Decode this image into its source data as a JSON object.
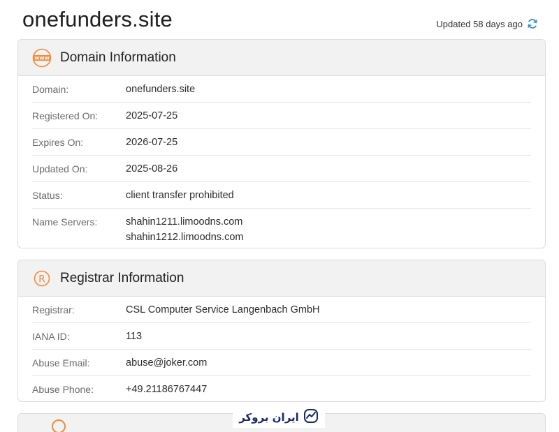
{
  "header": {
    "domain_title": "onefunders.site",
    "updated_text": "Updated 58 days ago"
  },
  "domain_info": {
    "title": "Domain Information",
    "icon": "www-icon",
    "rows": [
      {
        "label": "Domain:",
        "values": [
          "onefunders.site"
        ]
      },
      {
        "label": "Registered On:",
        "values": [
          "2025-07-25"
        ]
      },
      {
        "label": "Expires On:",
        "values": [
          "2026-07-25"
        ]
      },
      {
        "label": "Updated On:",
        "values": [
          "2025-08-26"
        ]
      },
      {
        "label": "Status:",
        "values": [
          "client transfer prohibited"
        ]
      },
      {
        "label": "Name Servers:",
        "values": [
          "shahin1211.limoodns.com",
          "shahin1212.limoodns.com"
        ]
      }
    ]
  },
  "registrar_info": {
    "title": "Registrar Information",
    "icon": "registered-icon",
    "rows": [
      {
        "label": "Registrar:",
        "values": [
          "CSL Computer Service Langenbach GmbH"
        ]
      },
      {
        "label": "IANA ID:",
        "values": [
          "113"
        ]
      },
      {
        "label": "Abuse Email:",
        "values": [
          "abuse@joker.com"
        ]
      },
      {
        "label": "Abuse Phone:",
        "values": [
          "+49.21186767447"
        ]
      }
    ]
  },
  "watermark": {
    "text": "ایران بروکر",
    "icon": "chart-logo-icon"
  },
  "colors": {
    "accent_orange": "#f08a3c",
    "refresh_blue": "#2f8fd8",
    "watermark_navy": "#1a2a6c",
    "header_bg": "#f2f2f2"
  }
}
